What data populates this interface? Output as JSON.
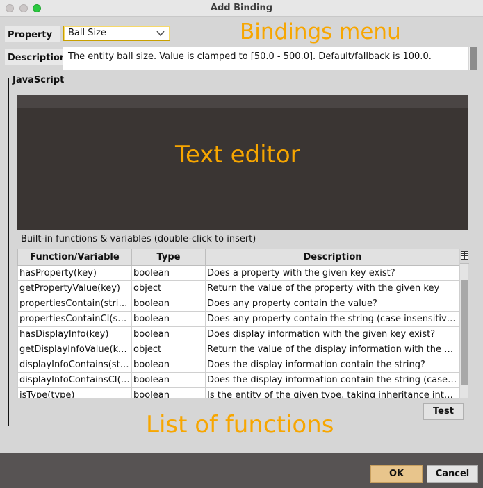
{
  "window": {
    "title": "Add Binding"
  },
  "property": {
    "label": "Property",
    "value": "Ball Size"
  },
  "description": {
    "label": "Description",
    "text": "The entity ball size. Value is clamped to [50.0 - 500.0]. Default/fallback is 100.0."
  },
  "overlays": {
    "bindings_menu": "Bindings menu",
    "text_editor": "Text editor",
    "list_of_functions": "List of functions"
  },
  "javascript": {
    "title": "JavaScript",
    "builtins_caption": "Built-in functions & variables (double-click to insert)"
  },
  "functions_table": {
    "headers": [
      "Function/Variable",
      "Type",
      "Description"
    ],
    "rows": [
      [
        "hasProperty(key)",
        "boolean",
        "Does a property with the given key exist?"
      ],
      [
        "getPropertyValue(key)",
        "object",
        "Return the value of the property with the given key"
      ],
      [
        "propertiesContain(string)",
        "boolean",
        "Does any property contain the value?"
      ],
      [
        "propertiesContainCI(str...",
        "boolean",
        "Does any property contain the string (case insensitive)?"
      ],
      [
        "hasDisplayInfo(key)",
        "boolean",
        "Does display information with the given key exist?"
      ],
      [
        "getDisplayInfoValue(key)",
        "object",
        "Return the value of the display information with the giv..."
      ],
      [
        "displayInfoContains(str...",
        "boolean",
        "Does the display information contain the string?"
      ],
      [
        "displayInfoContainsCI(s...",
        "boolean",
        "Does the display information contain the string (case i..."
      ],
      [
        "isType(type)",
        "boolean",
        "Is the entity of the given type, taking inheritance into a..."
      ]
    ]
  },
  "buttons": {
    "test": "Test",
    "ok": "OK",
    "cancel": "Cancel"
  },
  "colors": {
    "overlay": "#f7a600",
    "editor_bg": "#3a3533",
    "ok_bg": "#e8c58c",
    "footer_bg": "#575353"
  }
}
